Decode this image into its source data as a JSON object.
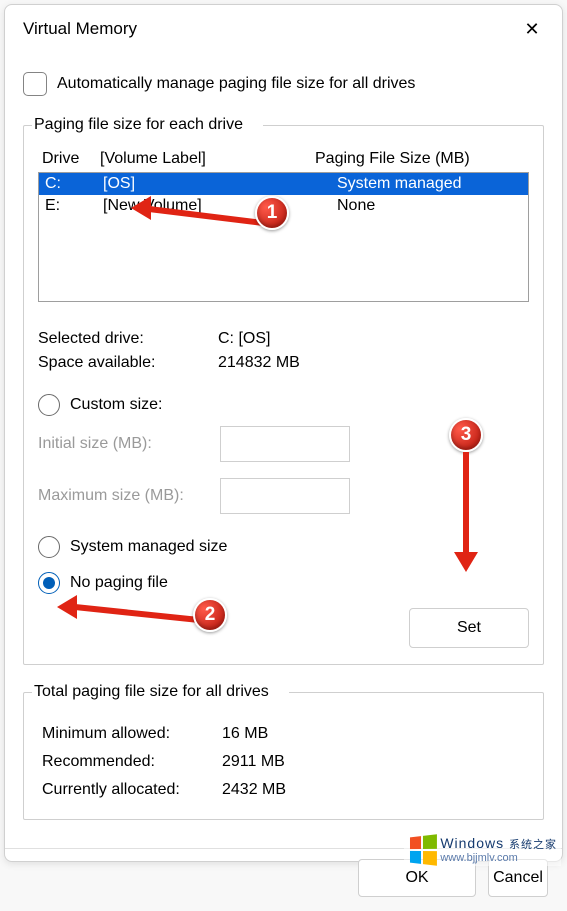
{
  "window": {
    "title": "Virtual Memory",
    "close_glyph": "✕"
  },
  "auto_manage": {
    "label": "Automatically manage paging file size for all drives",
    "checked": false
  },
  "group1": {
    "legend": "Paging file size for each drive",
    "header": {
      "drive": "Drive",
      "volume": "[Volume Label]",
      "pfs": "Paging File Size (MB)"
    },
    "rows": [
      {
        "drive": "C:",
        "volume": "[OS]",
        "pfs": "System managed",
        "selected": true
      },
      {
        "drive": "E:",
        "volume": "[New Volume]",
        "pfs": "None",
        "selected": false
      }
    ],
    "selected_drive_label": "Selected drive:",
    "selected_drive_value": "C:  [OS]",
    "space_label": "Space available:",
    "space_value": "214832 MB",
    "radio_custom": "Custom size:",
    "initial_label": "Initial size (MB):",
    "maximum_label": "Maximum size (MB):",
    "radio_system": "System managed size",
    "radio_none": "No paging file",
    "selected_radio": "none",
    "set_label": "Set"
  },
  "group2": {
    "legend": "Total paging file size for all drives",
    "min_label": "Minimum allowed:",
    "min_value": "16 MB",
    "rec_label": "Recommended:",
    "rec_value": "2911 MB",
    "cur_label": "Currently allocated:",
    "cur_value": "2432 MB"
  },
  "buttons": {
    "ok": "OK",
    "cancel": "Cancel"
  },
  "markers": {
    "1": "1",
    "2": "2",
    "3": "3"
  },
  "watermark": {
    "brand": "Windows",
    "tag": "系统之家",
    "url": "www.bjjmlv.com"
  }
}
